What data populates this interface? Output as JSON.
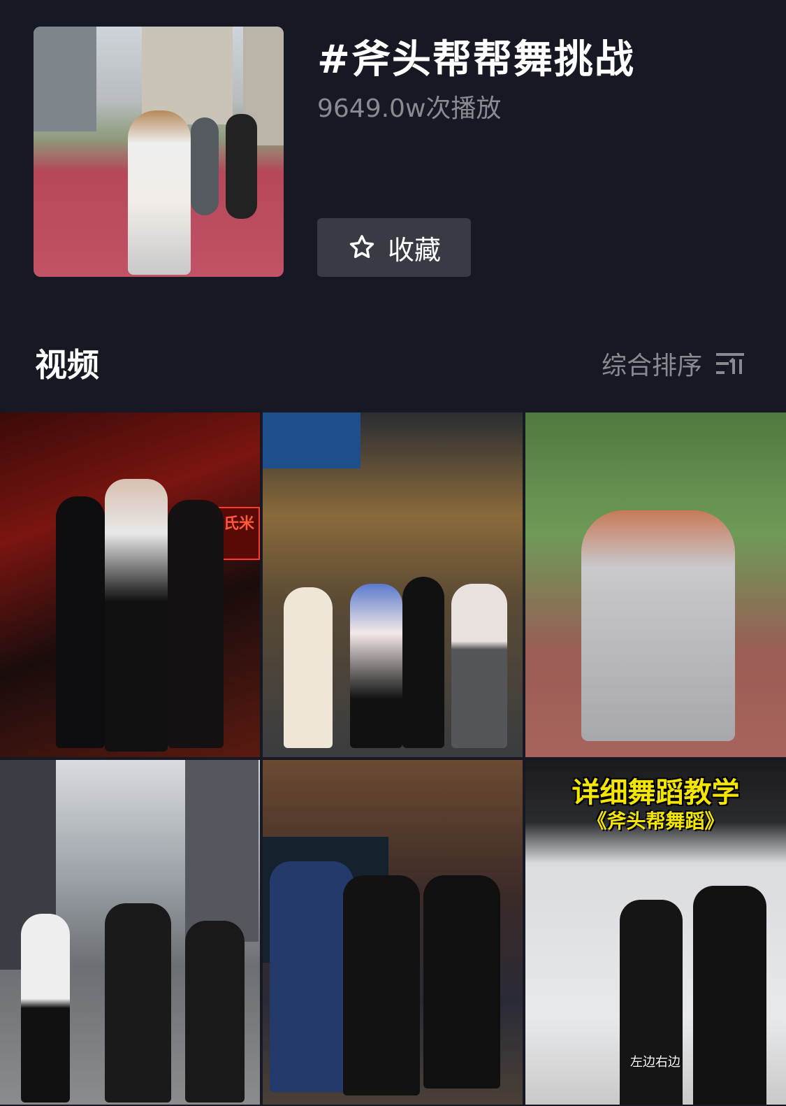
{
  "topic": {
    "title": "#斧头帮帮舞挑战",
    "play_count": "9649.0w次播放",
    "favorite_label": "收藏"
  },
  "section": {
    "title": "视频",
    "sort_label": "综合排序"
  },
  "videos": [
    {
      "sign_text": "胡氏米粉"
    },
    {},
    {},
    {},
    {},
    {
      "caption": "详细舞蹈教学",
      "subcaption": "《斧头帮舞蹈》",
      "subtitle": "左边右边"
    }
  ],
  "colors": {
    "background": "#161823",
    "button_bg": "#393b44",
    "muted_text": "#8a8b91",
    "caption_yellow": "#f4e600"
  },
  "icons": {
    "favorite": "star-outline-icon",
    "sort": "sort-filter-icon"
  }
}
